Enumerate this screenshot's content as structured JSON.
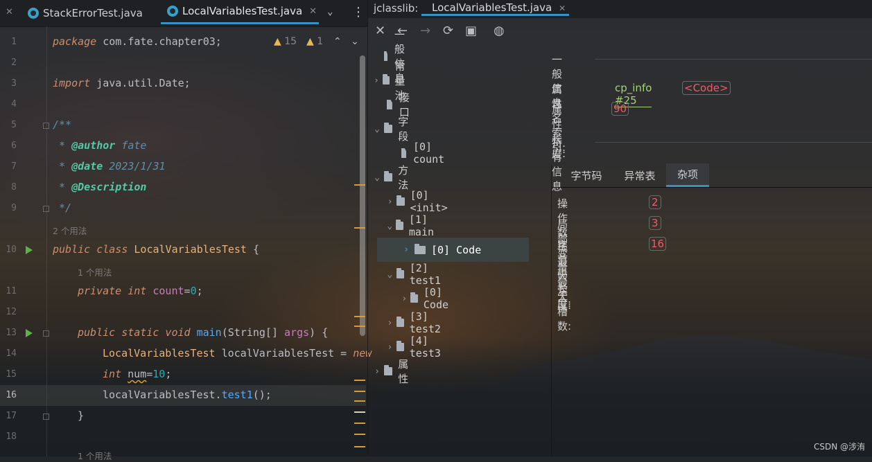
{
  "editor": {
    "tabs": [
      {
        "label": "StackErrorTest.java"
      },
      {
        "label": "LocalVariablesTest.java"
      }
    ],
    "inspections": {
      "warnings": "15",
      "weak_warnings": "1"
    },
    "lines": [
      {
        "n": "1"
      },
      {
        "n": "2"
      },
      {
        "n": "3"
      },
      {
        "n": "4"
      },
      {
        "n": "5"
      },
      {
        "n": "6"
      },
      {
        "n": "7"
      },
      {
        "n": "8"
      },
      {
        "n": "9"
      },
      {
        "n": "10"
      },
      {
        "n": "11"
      },
      {
        "n": "12"
      },
      {
        "n": "13"
      },
      {
        "n": "14"
      },
      {
        "n": "15"
      },
      {
        "n": "16"
      },
      {
        "n": "17"
      },
      {
        "n": "18"
      }
    ],
    "code": {
      "l1_kw": "package",
      "l1_rest": " com.fate.chapter03;",
      "l3_kw": "import",
      "l3_rest": " java.util.Date;",
      "l5": "/**",
      "l6_star": " * ",
      "l6_tag": "@author",
      "l6_val": " fate",
      "l7_star": " * ",
      "l7_tag": "@date",
      "l7_val": " 2023/1/31",
      "l8_star": " * ",
      "l8_tag": "@Description",
      "l9": " */",
      "hint_class": "2 个用法",
      "l10_kw": "public class ",
      "l10_cls": "LocalVariablesTest",
      "l10_rest": " {",
      "hint_field": "1 个用法",
      "l11_kw": "private int ",
      "l11_fld": "count",
      "l11_eq": "=",
      "l11_num": "0",
      "l11_end": ";",
      "l13_kw": "public static void ",
      "l13_meth": "main",
      "l13_p1": "(String[] ",
      "l13_param": "args",
      "l13_p2": ") {",
      "l14_cls": "LocalVariablesTest",
      "l14_var": " localVariablesTest = ",
      "l14_new": "new",
      "l15_kw": "int ",
      "l15_var": "num",
      "l15_eq": "=",
      "l15_num": "10",
      "l15_end": ";",
      "l16_obj": "localVariablesTest.",
      "l16_meth": "test1",
      "l16_end": "();",
      "l17": "}",
      "hint_bottom": "1 个用法"
    }
  },
  "jclasslib": {
    "label": "jclasslib:",
    "tab": "LocalVariablesTest.java",
    "tree": [
      {
        "label": "一般信息"
      },
      {
        "label": "常量池"
      },
      {
        "label": "接口"
      },
      {
        "label": "字段"
      },
      {
        "label": "[0] count"
      },
      {
        "label": "方法"
      },
      {
        "label": "[0] <init>"
      },
      {
        "label": "[1] main"
      },
      {
        "label": "[0] Code"
      },
      {
        "label": "[2] test1"
      },
      {
        "label": "[0] Code"
      },
      {
        "label": "[3] test2"
      },
      {
        "label": "[4] test3"
      },
      {
        "label": "属性"
      }
    ],
    "detail": {
      "general_title": "一般信息",
      "attr_name_label": "属性名索引:",
      "attr_name_link": "cp_info #25",
      "attr_name_value": "<Code>",
      "attr_len_label": "属性长度:",
      "attr_len_value": "90",
      "specific_title": "特有信息",
      "tabs": [
        "字节码",
        "异常表",
        "杂项"
      ],
      "max_stack_label": "操作数栈最大深度:",
      "max_stack_value": "2",
      "max_locals_label": "局部变量最大槽数:",
      "max_locals_value": "3",
      "code_len_label": "字节码长度:",
      "code_len_value": "16"
    }
  },
  "watermark": "CSDN @涉洧"
}
